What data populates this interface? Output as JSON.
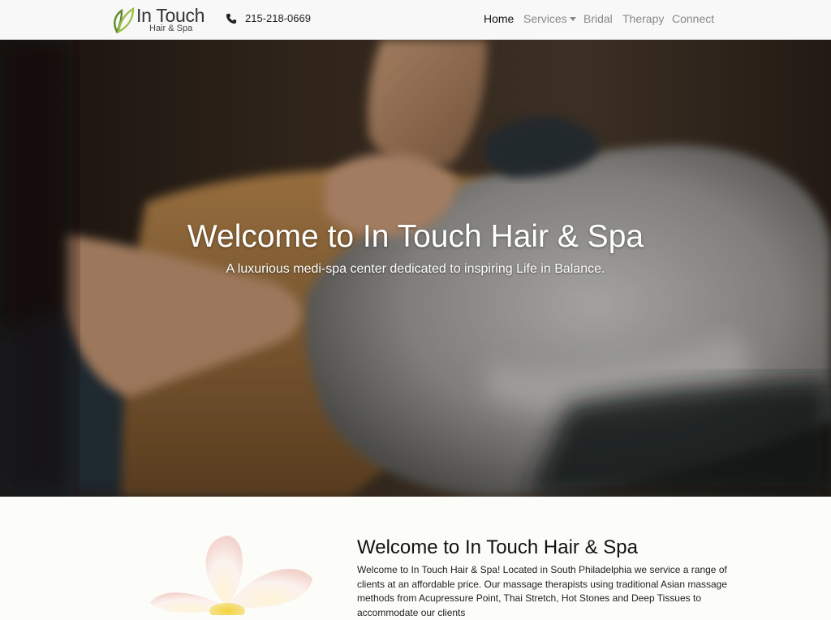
{
  "brand": {
    "name": "In Touch",
    "subtitle": "Hair & Spa",
    "colors": {
      "leaf_dark": "#5c8a2c",
      "leaf_light": "#9cc04a"
    }
  },
  "contact": {
    "phone": "215-218-0669",
    "phone_icon": "phone-icon"
  },
  "nav": {
    "home": "Home",
    "services": "Services",
    "bridal": "Bridal",
    "therapy": "Therapy",
    "connect": "Connect"
  },
  "hero": {
    "title": "Welcome to In Touch Hair & Spa",
    "subtitle": "A luxurious medi-spa center dedicated to inspiring Life in Balance."
  },
  "intro": {
    "title": "Welcome to In Touch Hair & Spa",
    "body": "Welcome to In Touch Hair & Spa! Located in South Philadelphia we service a range of clients at an affordable price. Our massage therapists using traditional Asian massage methods from Acupressure Point, Thai Stretch, Hot Stones and Deep Tissues to accommodate our clients"
  }
}
